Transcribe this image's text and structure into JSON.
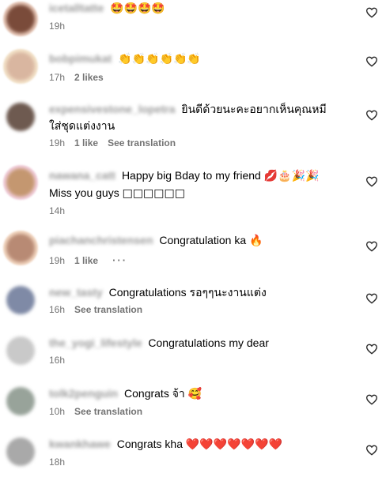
{
  "comments": [
    {
      "username": "icetalltatte",
      "text": "",
      "emoji": "🤩🤩🤩🤩",
      "time": "19h",
      "likes": "",
      "translate": "",
      "avatar_color": "#7a4b3a",
      "ring_color": "#e8c8b8"
    },
    {
      "username": "bobpimukat",
      "text": "",
      "emoji": "👏👏👏👏👏👏",
      "time": "17h",
      "likes": "2 likes",
      "translate": "",
      "avatar_color": "#d9b6a0",
      "ring_color": "#f3e2c8"
    },
    {
      "username": "expensivestone_lopetra",
      "text": "ยินดีด้วยนะคะอยากเห็นคุณหมีใส่ชุดแต่งงาน",
      "emoji": "",
      "time": "19h",
      "likes": "1 like",
      "translate": "See translation",
      "avatar_color": "#6e5a50",
      "ring_color": "#ffffff"
    },
    {
      "username": "nawana_catt",
      "text": "Happy big Bday to my friend",
      "emoji": "💋🎂🎉🎉",
      "text2": "Miss you guys",
      "boxes": "□□□□□□",
      "time": "14h",
      "likes": "",
      "translate": "",
      "avatar_color": "#c49770",
      "ring_color": "#f1cddb"
    },
    {
      "username": "piachanchristensen",
      "text": "Congratulation ka",
      "emoji": "🔥",
      "time": "19h",
      "likes": "1 like",
      "translate": "",
      "more": "···",
      "avatar_color": "#b88a74",
      "ring_color": "#f2d6c0"
    },
    {
      "username": "new_tasty",
      "text": "Congratulations รอๆๆนะงานแต่ง",
      "emoji": "",
      "time": "16h",
      "likes": "",
      "translate": "See translation",
      "avatar_color": "#7f8aa6",
      "ring_color": "#ffffff"
    },
    {
      "username": "the_yogi_lifestyle",
      "text": "Congratulations my dear",
      "emoji": "",
      "time": "16h",
      "likes": "",
      "translate": "",
      "avatar_color": "#c9c9c9",
      "ring_color": "#ffffff"
    },
    {
      "username": "tolk2penguin",
      "text": "Congrats จ้า",
      "emoji": "🥰",
      "time": "10h",
      "likes": "",
      "translate": "See translation",
      "avatar_color": "#98a39a",
      "ring_color": "#ffffff"
    },
    {
      "username": "kwankhawe",
      "text": "Congrats kha",
      "emoji": "❤️❤️❤️❤️❤️❤️❤️",
      "time": "18h",
      "likes": "",
      "translate": "",
      "avatar_color": "#a9a9a9",
      "ring_color": "#ffffff"
    }
  ],
  "colors": {
    "meta": "#737373",
    "heart_stroke": "#262626",
    "emoji_heart": "#e0244a"
  }
}
